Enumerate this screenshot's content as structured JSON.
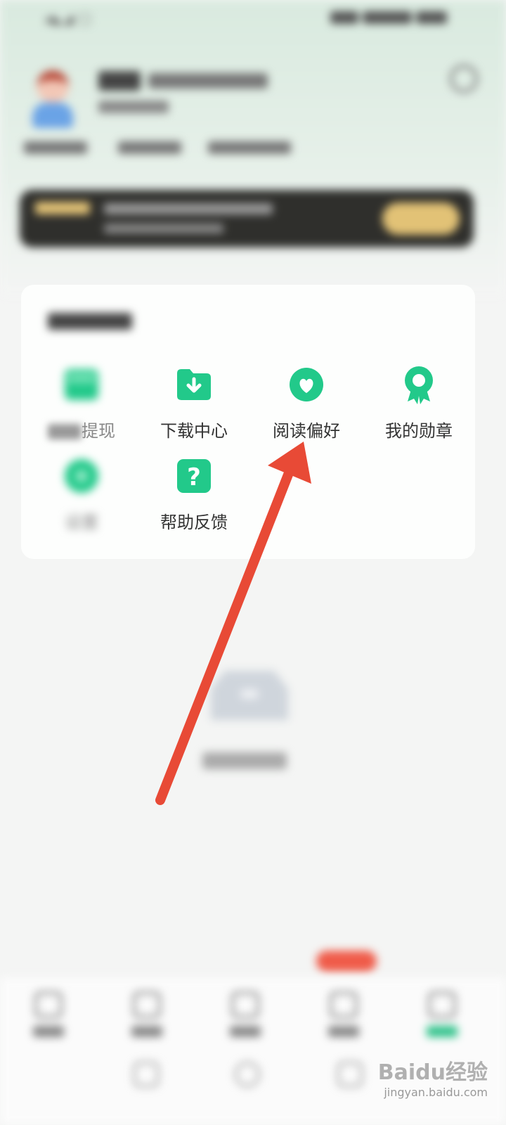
{
  "status_bar": {
    "left_text": "%%%"
  },
  "profile": {
    "username": "",
    "subtitle": ""
  },
  "services": {
    "title": "",
    "items": [
      {
        "label": "提现",
        "faded_prefix": "",
        "icon": "wallet-icon"
      },
      {
        "label": "下载中心",
        "icon": "download-folder-icon"
      },
      {
        "label": "阅读偏好",
        "icon": "heart-icon"
      },
      {
        "label": "我的勋章",
        "icon": "medal-icon"
      },
      {
        "label": "设置",
        "icon": "gear-icon"
      },
      {
        "label": "帮助反馈",
        "icon": "help-icon"
      }
    ]
  },
  "colors": {
    "accent_green": "#22c98a",
    "arrow_red": "#e84a36",
    "vip_gold": "#e2c276"
  },
  "watermark": {
    "main": "Baidu经验",
    "sub": "jingyan.baidu.com"
  }
}
